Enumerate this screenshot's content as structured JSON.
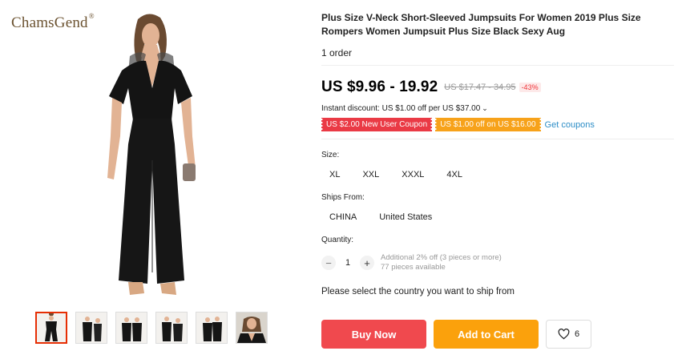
{
  "brand": {
    "name": "ChamsGend",
    "mark": "®"
  },
  "product": {
    "title": "Plus Size V-Neck Short-Sleeved Jumpsuits For Women 2019 Plus Size Rompers Women Jumpsuit Plus Size Black Sexy Aug",
    "orders": "1 order",
    "price": "US $9.96 - 19.92",
    "original_price": "US $17.47 - 34.95",
    "discount": "-43%"
  },
  "promo": {
    "instant_discount": "Instant discount: US $1.00 off per US $37.00",
    "coupons": [
      "US $2.00 New User Coupon",
      "US $1.00 off on US $16.00"
    ],
    "get_coupons": "Get coupons"
  },
  "size": {
    "label": "Size:",
    "options": [
      "XL",
      "XXL",
      "XXXL",
      "4XL"
    ]
  },
  "ships_from": {
    "label": "Ships From:",
    "options": [
      "CHINA",
      "United States"
    ]
  },
  "quantity": {
    "label": "Quantity:",
    "minus": "−",
    "value": "1",
    "plus": "+",
    "additional": "Additional 2% off (3 pieces or more)",
    "available": "77 pieces available"
  },
  "ship_note": "Please select the country you want to ship from",
  "actions": {
    "buy_now": "Buy Now",
    "add_to_cart": "Add to Cart",
    "wishlist_count": "6"
  },
  "gallery": {
    "thumbnail_count": 6,
    "active_index": 0
  },
  "colors": {
    "price": "#000000",
    "buy_button": "#f0494e",
    "cart_button": "#fba10c",
    "coupon_red": "#ea3a45",
    "coupon_orange": "#f7a21a",
    "link": "#2e8ec7"
  },
  "icons": [
    "heart-icon",
    "chevron-down-icon"
  ]
}
